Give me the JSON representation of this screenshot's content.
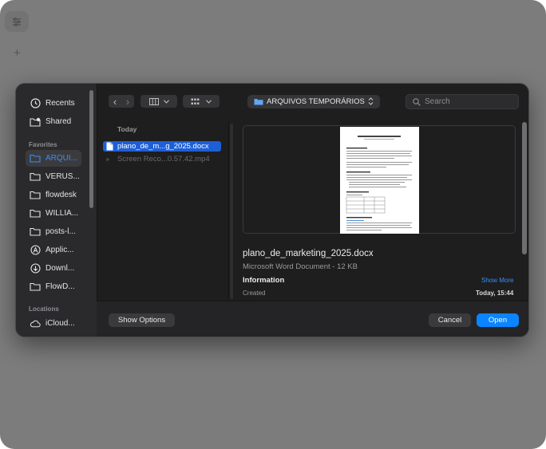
{
  "background": {
    "sidebar_toggle_icon": "sliders-icon",
    "new_item_label": "+"
  },
  "dialog": {
    "sidebar": {
      "sections": {
        "favorites": "Favorites",
        "locations": "Locations"
      },
      "top_items": [
        {
          "label": "Recents",
          "icon": "clock-icon"
        },
        {
          "label": "Shared",
          "icon": "shared-folder-icon"
        }
      ],
      "favorites": [
        {
          "label": "ARQUI...",
          "icon": "folder-icon",
          "selected": true
        },
        {
          "label": "VERUS...",
          "icon": "folder-icon"
        },
        {
          "label": "flowdesk",
          "icon": "folder-icon"
        },
        {
          "label": "WILLIA...",
          "icon": "folder-icon"
        },
        {
          "label": "posts-l...",
          "icon": "folder-icon"
        },
        {
          "label": "Applic...",
          "icon": "applications-icon"
        },
        {
          "label": "Downl...",
          "icon": "download-icon"
        },
        {
          "label": "FlowD...",
          "icon": "folder-icon"
        }
      ],
      "locations": [
        {
          "label": "iCloud...",
          "icon": "cloud-icon"
        }
      ]
    },
    "toolbar": {
      "back": "‹",
      "forward": "›",
      "current_folder": "ARQUIVOS TEMPORÁRIOS",
      "search_placeholder": "Search"
    },
    "file_list": {
      "group": "Today",
      "files": [
        {
          "name": "plano_de_m...g_2025.docx",
          "selected": true
        },
        {
          "name": "Screen Reco...0.57.42.mp4",
          "selected": false
        }
      ]
    },
    "preview": {
      "file_name": "plano_de_marketing_2025.docx",
      "kind_size": "Microsoft Word Document - 12 KB",
      "information_label": "Information",
      "show_more": "Show More",
      "created_label": "Created",
      "created_value": "Today, 15:44"
    },
    "buttons": {
      "show_options": "Show Options",
      "cancel": "Cancel",
      "open": "Open"
    },
    "colors": {
      "accent": "#0a84ff",
      "selection": "#1f5fd6"
    }
  }
}
